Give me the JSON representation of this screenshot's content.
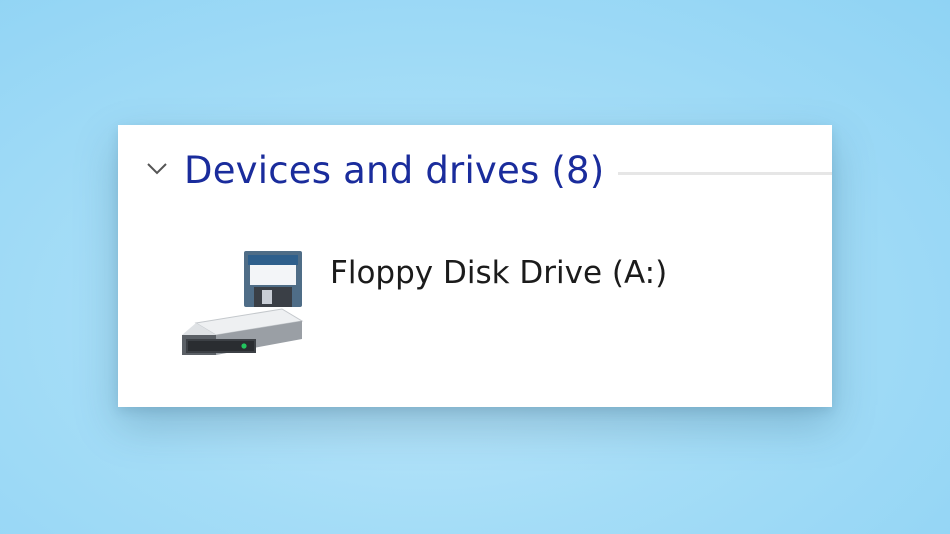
{
  "group": {
    "title": "Devices and drives (8)",
    "expanded": true,
    "chevron_icon": "chevron-down-icon"
  },
  "drives": [
    {
      "label": "Floppy Disk Drive (A:)",
      "icon": "floppy-disk-drive-icon"
    }
  ],
  "colors": {
    "group_title": "#1a2c9c",
    "background": "#a5ddf7",
    "panel": "#ffffff",
    "drive_led": "#22c55e"
  }
}
